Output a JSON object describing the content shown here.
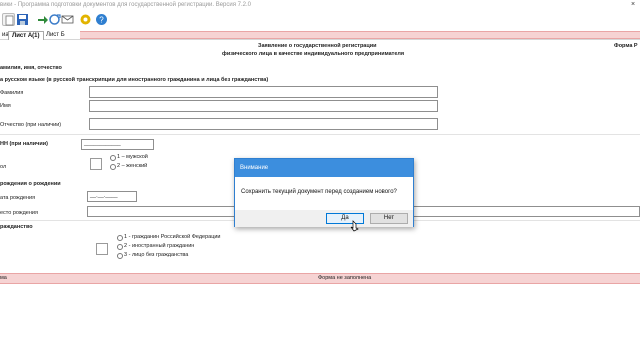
{
  "window": {
    "title": "вики - Программа подготовки документов для государственной регистрации. Версия 7.2.0",
    "title_prefix": "о"
  },
  "toolbar": {
    "buttons": [
      {
        "name": "new-icon"
      },
      {
        "name": "save-icon"
      },
      {
        "name": "import-icon"
      },
      {
        "name": "export-icon"
      },
      {
        "name": "mail-icon"
      },
      {
        "name": "settings-icon"
      },
      {
        "name": "help-icon"
      }
    ]
  },
  "tabs": [
    {
      "label": "иа",
      "active": false
    },
    {
      "label": "Лист А(1)",
      "active": true
    },
    {
      "label": "Лист Б",
      "active": false
    }
  ],
  "header": {
    "title_line1": "Заявление о государственной регистрации",
    "title_line2": "физического лица в качестве индивидуального предпринимателя",
    "form_code": "Форма Р"
  },
  "section_name": {
    "heading": "амилия, имя, отчество",
    "subheading": "а русском языке (в русской транскрипции для иностранного гражданина и лица без гражданства)",
    "fields": [
      {
        "label": "Фамилия",
        "value": ""
      },
      {
        "label": "Имя",
        "value": ""
      },
      {
        "label": "Отчество (при наличии)",
        "value": ""
      }
    ]
  },
  "section_inn": {
    "label": "НН (при наличии)",
    "value": "____________"
  },
  "section_gender": {
    "label": "ол",
    "options": [
      "1 – мужской",
      "2 – женский"
    ]
  },
  "section_birth": {
    "heading": "рождения о рождении",
    "date_label": "ата рождения",
    "date_value": "__.__.____",
    "place_label": "есто рождения"
  },
  "section_citizenship": {
    "heading": "ражданство",
    "options": [
      "1 - гражданин Российской Федерации",
      "2 - иностранный гражданин",
      "3 - лицо без гражданства"
    ]
  },
  "status_bar": {
    "left": "ма",
    "center": "Форма не заполнена"
  },
  "dialog": {
    "title": "Внимание",
    "message": "Сохранить текущий документ перед созданием нового?",
    "yes_label": "Да",
    "no_label": "Нет"
  },
  "colors": {
    "dialog_title_bg": "#3c8ede",
    "pink_bar": "#f6d3d3",
    "accent_border": "#0078d7"
  }
}
